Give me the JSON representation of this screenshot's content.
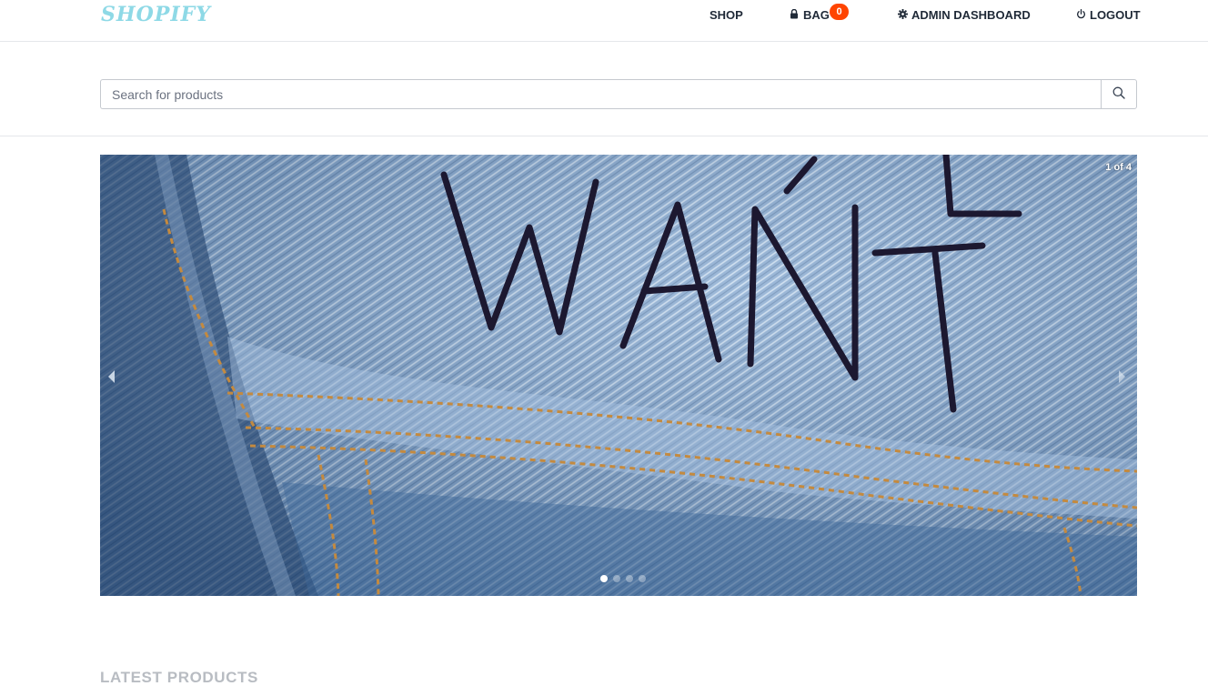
{
  "navbar": {
    "brand": "SHOPIFY",
    "shop_label": "SHOP",
    "bag_label": "BAG",
    "bag_count": "0",
    "admin_label": "ADMIN DASHBOARD",
    "logout_label": "LOGOUT",
    "icons": {
      "bag": "lock-icon",
      "admin": "gear-icon",
      "logout": "power-icon"
    },
    "badge_color": "#ff4400",
    "brand_color": "#8ed9e6"
  },
  "search": {
    "placeholder": "Search for products",
    "value": "",
    "icon": "search-icon"
  },
  "carousel": {
    "counter": "1 of 4",
    "slide_text": "WE WANT",
    "current_slide": 1,
    "total_slides": 4,
    "icons": {
      "prev": "caret-left-icon",
      "next": "caret-right-icon"
    }
  },
  "latest": {
    "title": "LATEST PRODUCTS"
  }
}
